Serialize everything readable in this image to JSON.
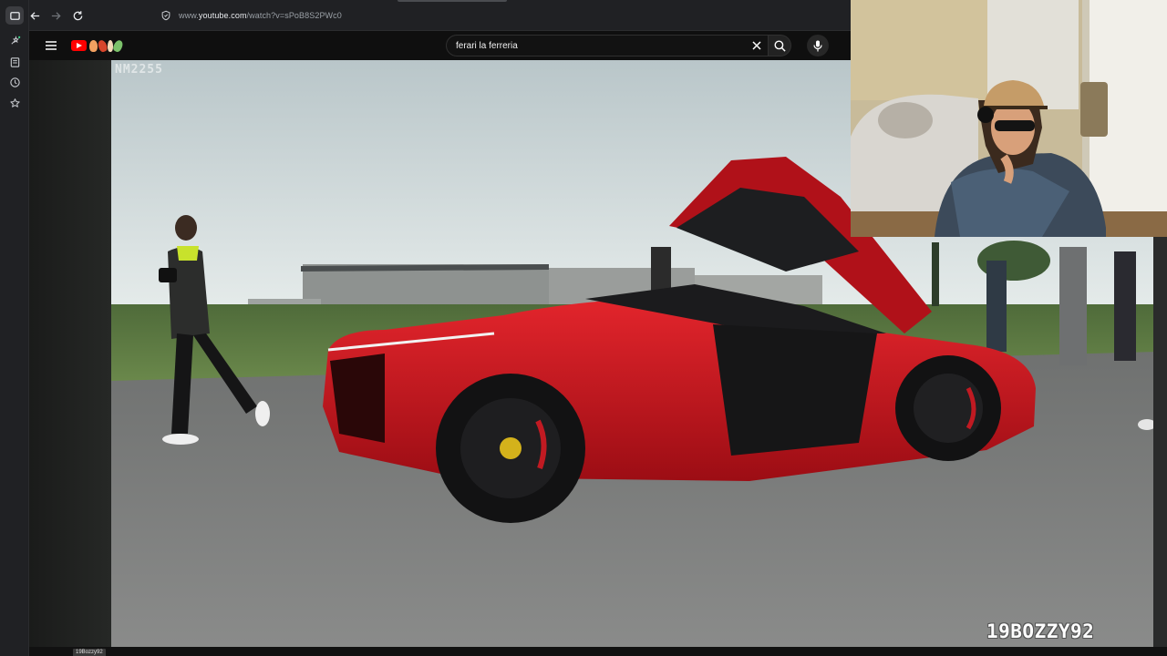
{
  "browser": {
    "url_prefix": "www.",
    "url_host": "youtube.com",
    "url_path": "/watch?v=sPoB8S2PWc0",
    "sidebar_icons": [
      "tabs-icon",
      "extensions-icon",
      "reading-list-icon",
      "history-icon",
      "favorites-icon"
    ],
    "nav_icons": [
      "back-icon",
      "forward-icon",
      "reload-icon",
      "site-info-icon"
    ]
  },
  "youtube": {
    "search_query": "ferari la ferreria",
    "icons": [
      "menu-icon",
      "youtube-logo",
      "clear-search-icon",
      "search-icon",
      "microphone-icon"
    ]
  },
  "video": {
    "watermark": "NM2255"
  },
  "stream": {
    "channel_watermark": "19BOZZY92",
    "viewer_tag": "19Bozzy92"
  },
  "colors": {
    "car_red": "#c4121a",
    "youtube_red": "#ff0000",
    "dark_bg": "#0f0f0f"
  }
}
